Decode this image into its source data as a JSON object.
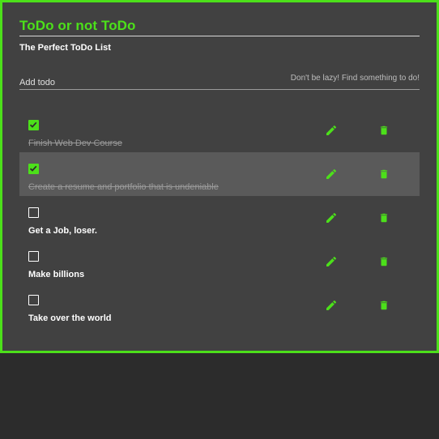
{
  "header": {
    "title": "ToDo or not ToDo",
    "subtitle": "The Perfect ToDo List"
  },
  "add_todo": {
    "placeholder": "Add todo",
    "hint": "Don't be lazy! Find something to do!"
  },
  "todos": [
    {
      "text": "Finish Web Dev Course",
      "completed": true
    },
    {
      "text": "Create a resume and portfolio that is undeniable",
      "completed": true
    },
    {
      "text": "Get a Job, loser.",
      "completed": false
    },
    {
      "text": "Make billions",
      "completed": false
    },
    {
      "text": "Take over the world",
      "completed": false
    }
  ],
  "icons": {
    "edit": "pencil-icon",
    "delete": "trash-icon",
    "check": "checkmark-icon"
  },
  "colors": {
    "accent": "#4ce01a",
    "card_background": "#414141",
    "page_background": "#2c2c2c",
    "hovered_row": "#5a5a5a"
  }
}
